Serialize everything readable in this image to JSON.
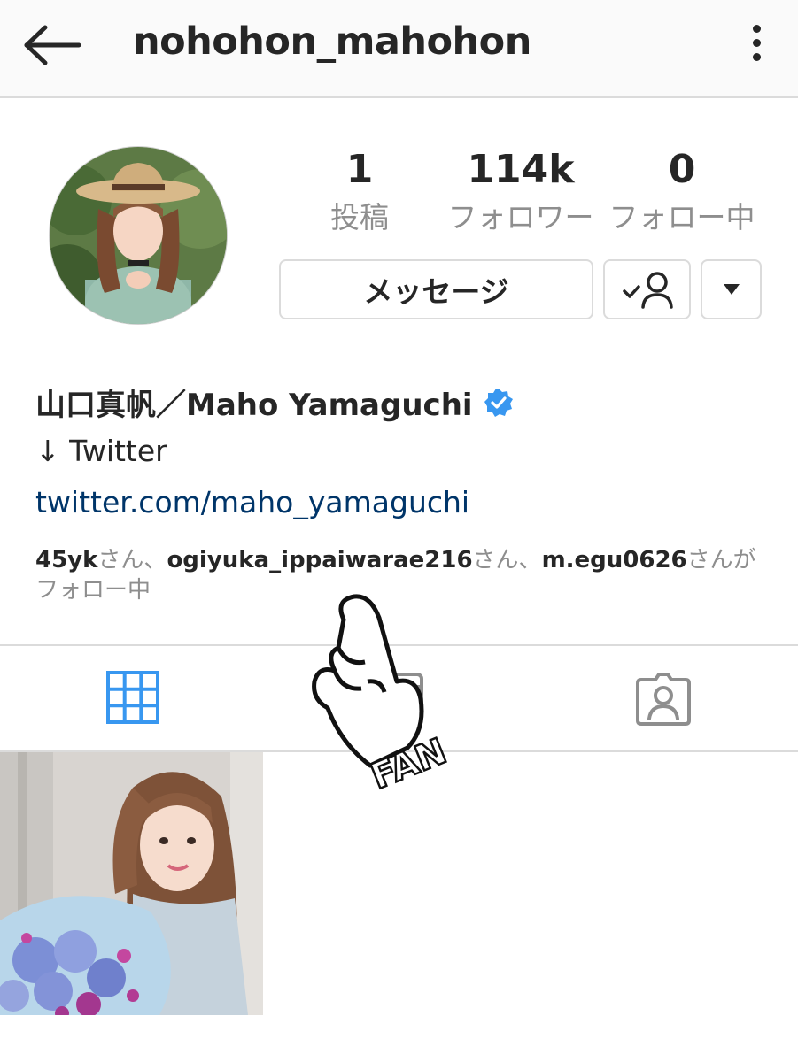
{
  "header": {
    "username": "nohohon_mahohon"
  },
  "stats": [
    {
      "value": "1",
      "label": "投稿"
    },
    {
      "value": "114k",
      "label": "フォロワー"
    },
    {
      "value": "0",
      "label": "フォロー中"
    }
  ],
  "actions": {
    "message_label": "メッセージ"
  },
  "bio": {
    "full_name": "山口真帆／Maho Yamaguchi",
    "line": "↓ Twitter",
    "link": "twitter.com/maho_yamaguchi"
  },
  "followed_by": {
    "users": [
      "45yk",
      "ogiyuka_ippaiwarae216",
      "m.egu0626"
    ],
    "sep1": "さん、",
    "sep2": "さん、",
    "suffix": "さんが",
    "line2": "フォロー中"
  },
  "overlay": {
    "text": "FAN"
  },
  "tabs": [
    {
      "icon": "grid-icon",
      "active": true
    },
    {
      "icon": "list-icon",
      "active": false
    },
    {
      "icon": "tagged-icon",
      "active": false
    }
  ],
  "colors": {
    "accent": "#3897f0",
    "link": "#003569",
    "muted": "#8e8e8e",
    "text": "#262626",
    "border": "#dbdbdb"
  }
}
